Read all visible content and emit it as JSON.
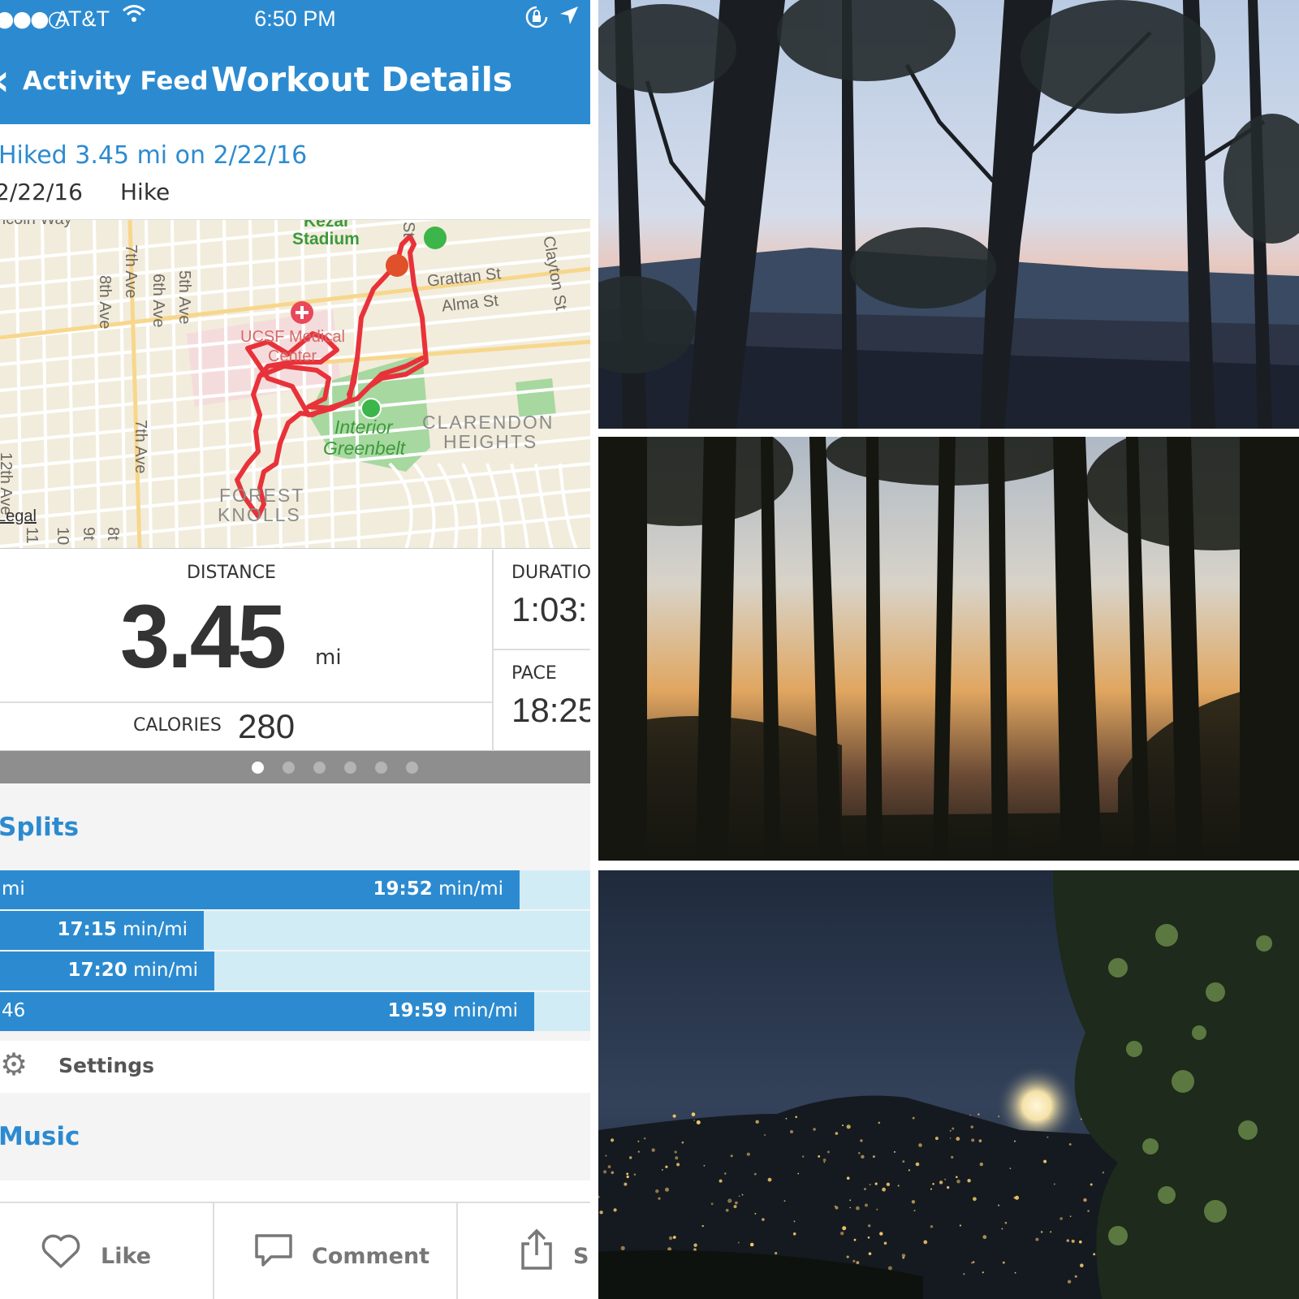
{
  "status_bar": {
    "signal": "●●●○",
    "carrier": "AT&T",
    "time": "6:50 PM"
  },
  "nav": {
    "back_label": "Activity Feed",
    "title": "Workout Details"
  },
  "workout": {
    "title": "Hiked 3.45 mi on 2/22/16",
    "date": "2/22/16",
    "type": "Hike"
  },
  "map": {
    "labels": {
      "lincoln_way": "ncoln Way",
      "kezar": "Kezar",
      "stadium": "Stadium",
      "seventh_ave_top": "7th Ave",
      "eighth_ave": "8th Ave",
      "sixth_ave": "6th Ave",
      "fifth_ave": "5th Ave",
      "grattan": "Grattan St",
      "alma": "Alma St",
      "clayton": "Clayton St",
      "st_fragment": "St",
      "ucsf": "UCSF Medical",
      "center": "Center",
      "interior": "Interior",
      "greenbelt": "Greenbelt",
      "clarendon": "CLARENDON",
      "heights": "HEIGHTS",
      "seventh_ave_bottom": "7th Ave",
      "twelfth_ave": "12th Ave",
      "forest": "FOREST",
      "knolls": "KNOLLS",
      "legal": "Legal",
      "bottom_11": "11",
      "bottom_10": "10",
      "bottom_9": "9t",
      "bottom_8": "8t"
    },
    "colors": {
      "route": "#e8323a",
      "start": "#3cb54a",
      "end": "#e0502a",
      "park": "#a6d8a0",
      "hospital": "#f5dcdc",
      "background": "#f2ecdc",
      "street": "#ffffff",
      "major_street": "#f7d78c"
    }
  },
  "stats": {
    "distance_label": "DISTANCE",
    "distance_value": "3.45",
    "distance_unit": "mi",
    "calories_label": "CALORIES",
    "calories_value": "280",
    "duration_label": "DURATIO",
    "duration_value": "1:03:",
    "pace_label": "PACE",
    "pace_value": "18:25"
  },
  "pager": {
    "count": 6,
    "active_index": 0
  },
  "splits": {
    "title": "Splits",
    "rows": [
      {
        "mile": "mi",
        "pace": "19:52",
        "unit": "min/mi",
        "fill_fraction": 0.88
      },
      {
        "mile": "",
        "pace": "17:15",
        "unit": "min/mi",
        "fill_fraction": 0.345
      },
      {
        "mile": "",
        "pace": "17:20",
        "unit": "min/mi",
        "fill_fraction": 0.363
      },
      {
        "mile": "46",
        "pace": "19:59",
        "unit": "min/mi",
        "fill_fraction": 0.905
      }
    ],
    "settings_label": "Settings"
  },
  "music": {
    "title": "Music"
  },
  "actions": {
    "like": "Like",
    "comment": "Comment",
    "share": "Sh"
  },
  "icons": {
    "back": "chevron-left-icon",
    "wifi": "wifi-icon",
    "lock": "rotation-lock-icon",
    "location": "location-arrow-icon",
    "settings": "gear-icon",
    "like": "heart-icon",
    "comment": "speech-bubble-icon",
    "share": "share-icon"
  },
  "colors": {
    "brand_blue": "#2c8bd0",
    "split_track": "#d2ecf6",
    "pager_bg": "#8e8e8e"
  }
}
